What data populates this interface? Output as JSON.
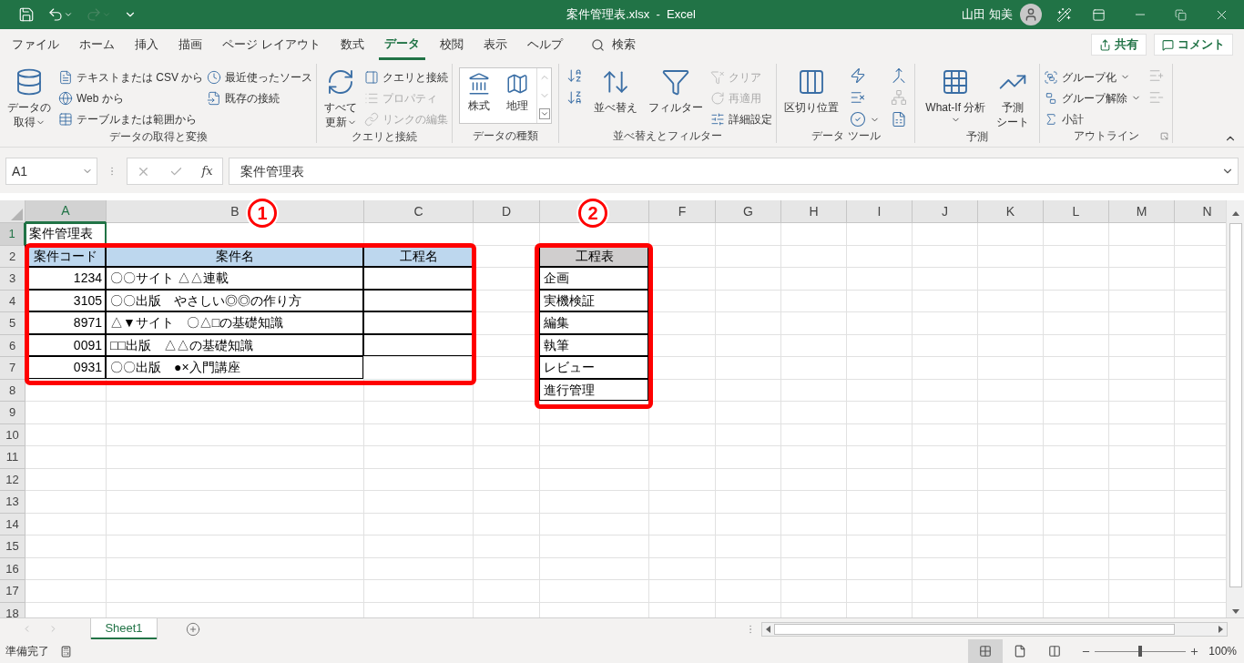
{
  "title_bar": {
    "quick_access": [
      {
        "kind": "save",
        "disabled": false
      },
      {
        "kind": "undo",
        "disabled": false
      },
      {
        "kind": "redo",
        "disabled": true
      },
      {
        "kind": "customize",
        "disabled": false
      }
    ],
    "title": "案件管理表.xlsx  -  Excel",
    "user": "山田 知美"
  },
  "menu_tabs": [
    {
      "label": "ファイル",
      "selected": false
    },
    {
      "label": "ホーム",
      "selected": false
    },
    {
      "label": "挿入",
      "selected": false
    },
    {
      "label": "描画",
      "selected": false
    },
    {
      "label": "ページ レイアウト",
      "selected": false
    },
    {
      "label": "数式",
      "selected": false
    },
    {
      "label": "データ",
      "selected": true
    },
    {
      "label": "校閲",
      "selected": false
    },
    {
      "label": "表示",
      "selected": false
    },
    {
      "label": "ヘルプ",
      "selected": false
    }
  ],
  "search": {
    "label": "検索"
  },
  "share_button": "共有",
  "comment_button": "コメント",
  "ribbon": {
    "groups": [
      {
        "label": "データの取得と変換",
        "dialog_launcher": false,
        "columns": [
          {
            "kind": "large",
            "items": [
              {
                "lines": [
                  "データの",
                  "取得"
                ],
                "disabled": false,
                "dropdown": true
              }
            ]
          },
          {
            "kind": "stack",
            "items": [
              {
                "lines": [
                  "テキストまたは CSV から"
                ],
                "disabled": false,
                "dropdown": false
              },
              {
                "lines": [
                  "Web から"
                ],
                "disabled": false,
                "dropdown": false
              },
              {
                "lines": [
                  "テーブルまたは範囲から"
                ],
                "disabled": false,
                "dropdown": false
              }
            ]
          },
          {
            "kind": "stack",
            "items": [
              {
                "lines": [
                  "最近使ったソース"
                ],
                "disabled": false,
                "dropdown": false
              },
              {
                "lines": [
                  "既存の接続"
                ],
                "disabled": false,
                "dropdown": false
              }
            ]
          }
        ]
      },
      {
        "label": "クエリと接続",
        "dialog_launcher": false,
        "columns": [
          {
            "kind": "large",
            "items": [
              {
                "lines": [
                  "すべて",
                  "更新"
                ],
                "disabled": false,
                "dropdown": true
              }
            ]
          },
          {
            "kind": "stack",
            "items": [
              {
                "lines": [
                  "クエリと接続"
                ],
                "disabled": false,
                "dropdown": false
              },
              {
                "lines": [
                  "プロパティ"
                ],
                "disabled": true,
                "dropdown": false
              },
              {
                "lines": [
                  "リンクの編集"
                ],
                "disabled": true,
                "dropdown": false
              }
            ]
          }
        ]
      },
      {
        "label": "データの種類",
        "dialog_launcher": false,
        "columns": [
          {
            "kind": "gallery",
            "items": [
              {
                "lines": [
                  "株式"
                ],
                "disabled": false
              },
              {
                "lines": [
                  "地理"
                ],
                "disabled": false
              }
            ]
          }
        ]
      },
      {
        "label": "並べ替えとフィルター",
        "dialog_launcher": false,
        "columns": [
          {
            "kind": "icons",
            "items": [
              {
                "disabled": false,
                "dropdown": false
              },
              {
                "disabled": false,
                "dropdown": false
              }
            ]
          },
          {
            "kind": "large",
            "items": [
              {
                "lines": [
                  "並べ替え"
                ],
                "disabled": false,
                "dropdown": false
              }
            ]
          },
          {
            "kind": "large",
            "items": [
              {
                "lines": [
                  "フィルター"
                ],
                "disabled": false,
                "dropdown": false
              }
            ]
          },
          {
            "kind": "stack",
            "items": [
              {
                "lines": [
                  "クリア"
                ],
                "disabled": true,
                "dropdown": false
              },
              {
                "lines": [
                  "再適用"
                ],
                "disabled": true,
                "dropdown": false
              },
              {
                "lines": [
                  "詳細設定"
                ],
                "disabled": false,
                "dropdown": false
              }
            ]
          }
        ]
      },
      {
        "label": "データ ツール",
        "dialog_launcher": false,
        "columns": [
          {
            "kind": "large",
            "items": [
              {
                "lines": [
                  "区切り位置"
                ],
                "disabled": false,
                "dropdown": false
              }
            ]
          },
          {
            "kind": "icons",
            "items": [
              {
                "disabled": false,
                "dropdown": false
              },
              {
                "disabled": false,
                "dropdown": false
              },
              {
                "disabled": false,
                "dropdown": true
              }
            ]
          },
          {
            "kind": "icons",
            "items": [
              {
                "disabled": false,
                "dropdown": false
              },
              {
                "disabled": true,
                "dropdown": false
              },
              {
                "disabled": false,
                "dropdown": false
              }
            ]
          }
        ]
      },
      {
        "label": "予測",
        "dialog_launcher": false,
        "columns": [
          {
            "kind": "large",
            "items": [
              {
                "lines": [
                  "What-If 分析"
                ],
                "disabled": false,
                "dropdown": true
              }
            ]
          },
          {
            "kind": "large",
            "items": [
              {
                "lines": [
                  "予測",
                  "シート"
                ],
                "disabled": false,
                "dropdown": false
              }
            ]
          }
        ]
      },
      {
        "label": "アウトライン",
        "dialog_launcher": true,
        "columns": [
          {
            "kind": "stack",
            "items": [
              {
                "lines": [
                  "グループ化"
                ],
                "disabled": false,
                "dropdown": true
              },
              {
                "lines": [
                  "グループ解除"
                ],
                "disabled": false,
                "dropdown": true
              },
              {
                "lines": [
                  "小計"
                ],
                "disabled": false,
                "dropdown": false
              }
            ]
          },
          {
            "kind": "icons",
            "items": [
              {
                "disabled": true,
                "dropdown": false
              },
              {
                "disabled": true,
                "dropdown": false
              }
            ]
          }
        ]
      }
    ]
  },
  "formula_bar": {
    "name_box": "A1",
    "fx": "fx",
    "value": "案件管理表"
  },
  "sheet": {
    "columns": [
      {
        "label": "A",
        "selected": true
      },
      {
        "label": "B",
        "selected": false
      },
      {
        "label": "C",
        "selected": false
      },
      {
        "label": "D",
        "selected": false
      },
      {
        "selected": false
      },
      {
        "label": "F",
        "selected": false
      },
      {
        "label": "G",
        "selected": false
      },
      {
        "label": "H",
        "selected": false
      },
      {
        "label": "I",
        "selected": false
      },
      {
        "label": "J",
        "selected": false
      },
      {
        "label": "K",
        "selected": false
      },
      {
        "label": "L",
        "selected": false
      },
      {
        "label": "M",
        "selected": false
      },
      {
        "label": "N",
        "selected": false
      }
    ],
    "rows": [
      {
        "number": "1",
        "selected": true,
        "cells": [
          {
            "kind": "text",
            "text": "案件管理表",
            "bordered": false,
            "selected": true
          },
          {
            "kind": "empty",
            "bordered": false,
            "selected": false
          },
          {
            "kind": "empty",
            "bordered": false,
            "selected": false
          },
          {
            "kind": "empty",
            "bordered": false,
            "selected": false
          },
          {
            "kind": "empty",
            "bordered": false,
            "selected": false
          }
        ]
      },
      {
        "number": "2",
        "selected": false,
        "cells": [
          {
            "kind": "header",
            "text": "案件コード",
            "color": "#bdd7ee",
            "bordered": true,
            "selected": false
          },
          {
            "kind": "header",
            "text": "案件名",
            "color": "#bdd7ee",
            "bordered": true,
            "selected": false
          },
          {
            "kind": "header",
            "text": "工程名",
            "color": "#bdd7ee",
            "bordered": true,
            "selected": false
          },
          {
            "kind": "empty",
            "bordered": false,
            "selected": false
          },
          {
            "kind": "header",
            "text": "工程表",
            "color": "#d0cece",
            "bordered": true,
            "selected": false
          }
        ]
      },
      {
        "number": "3",
        "selected": false,
        "cells": [
          {
            "kind": "number",
            "text": "1234",
            "bordered": true,
            "selected": false
          },
          {
            "kind": "text",
            "text": "〇〇サイト △△連載",
            "bordered": true,
            "selected": false
          },
          {
            "kind": "empty",
            "bordered": true,
            "selected": false
          },
          {
            "kind": "empty",
            "bordered": false,
            "selected": false
          },
          {
            "kind": "text",
            "text": "企画",
            "bordered": true,
            "selected": false
          }
        ]
      },
      {
        "number": "4",
        "selected": false,
        "cells": [
          {
            "kind": "number",
            "text": "3105",
            "bordered": true,
            "selected": false
          },
          {
            "kind": "text",
            "text": "〇〇出版　やさしい◎◎の作り方",
            "bordered": true,
            "selected": false
          },
          {
            "kind": "empty",
            "bordered": true,
            "selected": false
          },
          {
            "kind": "empty",
            "bordered": false,
            "selected": false
          },
          {
            "kind": "text",
            "text": "実機検証",
            "bordered": true,
            "selected": false
          }
        ]
      },
      {
        "number": "5",
        "selected": false,
        "cells": [
          {
            "kind": "number",
            "text": "8971",
            "bordered": true,
            "selected": false
          },
          {
            "kind": "text",
            "text": "△▼サイト　〇△□の基礎知識",
            "bordered": true,
            "selected": false
          },
          {
            "kind": "empty",
            "bordered": true,
            "selected": false
          },
          {
            "kind": "empty",
            "bordered": false,
            "selected": false
          },
          {
            "kind": "text",
            "text": "編集",
            "bordered": true,
            "selected": false
          }
        ]
      },
      {
        "number": "6",
        "selected": false,
        "cells": [
          {
            "kind": "number",
            "text": "0091",
            "bordered": true,
            "selected": false
          },
          {
            "kind": "text",
            "text": "□□出版　△△の基礎知識",
            "bordered": true,
            "selected": false
          },
          {
            "kind": "empty",
            "bordered": true,
            "selected": false
          },
          {
            "kind": "empty",
            "bordered": false,
            "selected": false
          },
          {
            "kind": "text",
            "text": "執筆",
            "bordered": true,
            "selected": false
          }
        ]
      },
      {
        "number": "7",
        "selected": false,
        "cells": [
          {
            "kind": "number",
            "text": "0931",
            "bordered": true,
            "selected": false
          },
          {
            "kind": "text",
            "text": "〇〇出版　●×入門講座",
            "bordered": true,
            "selected": false
          },
          {
            "kind": "empty",
            "selected": false
          },
          {
            "kind": "empty",
            "bordered": false,
            "selected": false
          },
          {
            "kind": "text",
            "text": "レビュー",
            "bordered": true,
            "selected": false
          }
        ]
      },
      {
        "number": "8",
        "selected": false,
        "cells": [
          {
            "kind": "empty",
            "bordered": false,
            "selected": false
          },
          {
            "kind": "empty",
            "bordered": false,
            "selected": false
          },
          {
            "kind": "empty",
            "bordered": false,
            "selected": false
          },
          {
            "kind": "empty",
            "bordered": false,
            "selected": false
          },
          {
            "kind": "text",
            "text": "進行管理",
            "bordered": true,
            "selected": false
          }
        ]
      },
      {
        "number": "9",
        "selected": false
      },
      {
        "number": "10",
        "selected": false
      },
      {
        "number": "11",
        "selected": false
      },
      {
        "number": "12",
        "selected": false
      },
      {
        "number": "13",
        "selected": false
      },
      {
        "number": "14",
        "selected": false
      },
      {
        "number": "15",
        "selected": false
      },
      {
        "number": "16",
        "selected": false
      },
      {
        "number": "17",
        "selected": false
      },
      {
        "number": "18",
        "selected": false
      }
    ],
    "annotations": [
      {
        "label": "1"
      },
      {
        "label": "2"
      }
    ]
  },
  "sheet_tabs": [
    {
      "label": "Sheet1",
      "selected": true
    }
  ],
  "status_bar": {
    "status": "準備完了",
    "views": [
      {
        "kind": "normal",
        "selected": true
      },
      {
        "kind": "page_layout",
        "selected": false
      },
      {
        "kind": "page_break",
        "selected": false
      }
    ],
    "zoom": {
      "level": 0.5,
      "reading": "100%"
    }
  }
}
